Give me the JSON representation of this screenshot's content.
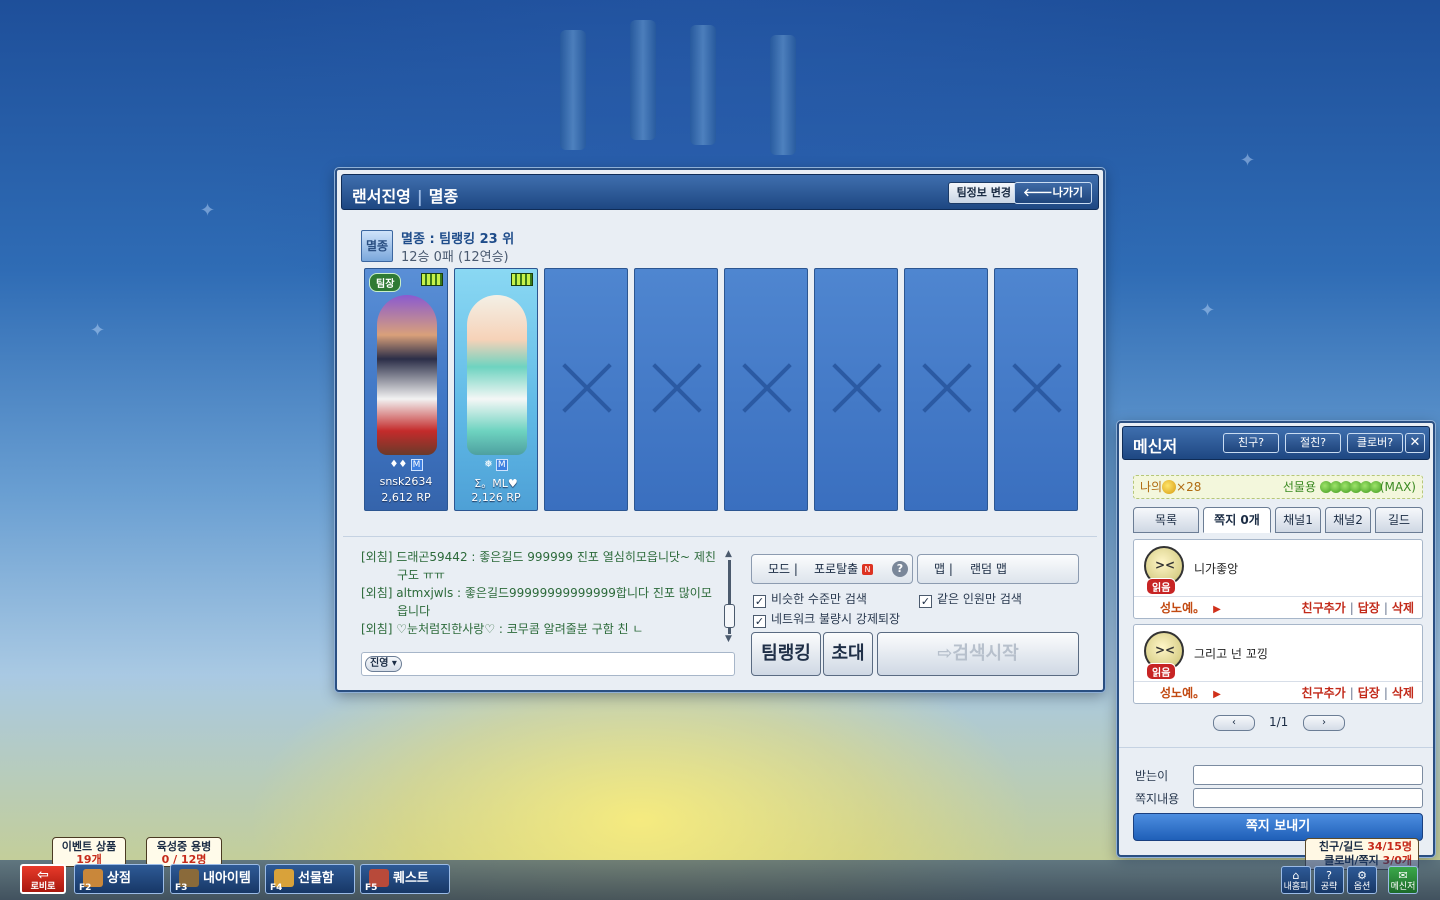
{
  "team_window": {
    "title": "랜서진영",
    "title_sep": "|",
    "subtitle": "멸종",
    "change_team_info": "팀정보 변경",
    "exit": "🡐나가기",
    "team_badge": "멸종",
    "team_rank": "멸종 : 팀랭킹 23 위",
    "team_record": "12승 0패 (12연승)",
    "slots": [
      {
        "leader": "팀장",
        "name": "snsk2634",
        "rp": "2,612 RP",
        "icons": "♦♦"
      },
      {
        "name": "Σ。ML♥",
        "rp": "2,126 RP",
        "icons": "❅"
      }
    ],
    "empty_slots": 6,
    "chat": [
      {
        "channel": "[외침]",
        "text": "드래곤59442 : 좋은길드 999999 진포 열심히모읍니닷~ 제친",
        "cont": "구도 ㅠㅠ"
      },
      {
        "channel": "[외침]",
        "text": "altmxjwls : 좋은길드99999999999999합니다 진포 많이모",
        "cont": "읍니다"
      },
      {
        "channel": "[외침]",
        "text": "♡눈처럼진한사랑♡ : 코무콤 알려줄분 구함 친 ㄴ",
        "cont": ""
      }
    ],
    "chat_channel": "진영",
    "mode_label": "모드",
    "mode_sep": "|",
    "mode_value": "포로탈출",
    "mode_new": "N",
    "map_label": "맵",
    "map_value": "랜덤 맵",
    "check_similar": "비슷한 수준만 검색",
    "check_same_count": "같은 인원만 검색",
    "check_network": "네트워크 불량시 강제퇴장",
    "btn_team_ranking": "팀랭킹",
    "btn_invite": "초대",
    "btn_search": "⇨검색시작"
  },
  "messenger": {
    "title": "메신저",
    "btn_friend": "친구?",
    "btn_best": "절친?",
    "btn_clover": "클로버?",
    "close": "✕",
    "my_label": "나의",
    "my_count": "×28",
    "gift_label": "선물용",
    "gift_max": "(MAX)",
    "tabs": [
      "목록",
      "쪽지 0개",
      "채널1",
      "채널2",
      "길드"
    ],
    "messages": [
      {
        "read": "읽음",
        "text": "니가좋앙",
        "sender": "성노예。",
        "add": "친구추가",
        "reply": "답장",
        "delete": "삭제"
      },
      {
        "read": "읽음",
        "text": "그리고 넌 꼬낑",
        "sender": "성노예。",
        "add": "친구추가",
        "reply": "답장",
        "delete": "삭제"
      }
    ],
    "pager_prev": "‹",
    "pager_next": "›",
    "pager_text": "1/1",
    "recipient_label": "받는이",
    "content_label": "쪽지내용",
    "send": "쪽지 보내기",
    "status_line1": "친구/길드",
    "status_line1_val": "34/15명",
    "status_line2": "클로버/쪽지",
    "status_line2_val": "3/0개"
  },
  "bottom_bar": {
    "lobby": "로비로",
    "shop_key": "F2",
    "shop": "상점",
    "items_key": "F3",
    "items": "내아이템",
    "gift_key": "F4",
    "gift": "선물함",
    "quest_key": "F5",
    "quest": "퀘스트",
    "event_tip_title": "이벤트 상품",
    "event_tip_val": "19개",
    "raise_tip_title": "육성중 용병",
    "raise_tip_val": "0 / 12명",
    "right_btns": [
      "내홈피",
      "공략",
      "옵션",
      "메신저"
    ]
  }
}
